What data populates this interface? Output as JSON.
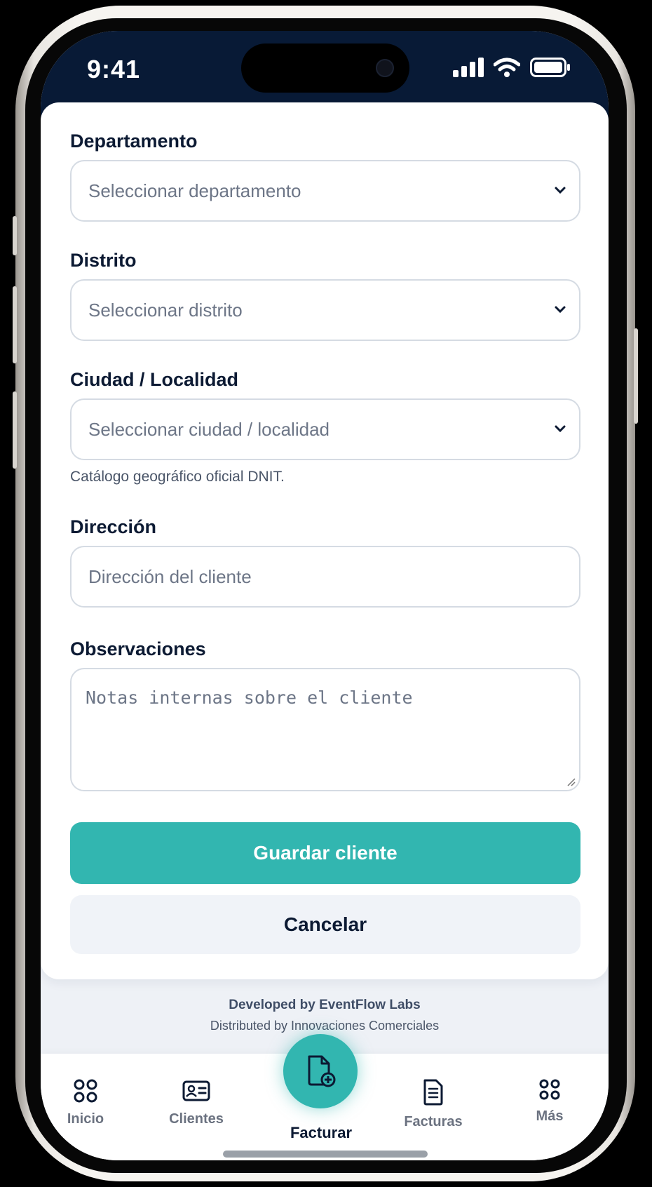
{
  "status_bar": {
    "time": "9:41"
  },
  "form": {
    "departamento": {
      "label": "Departamento",
      "placeholder": "Seleccionar departamento"
    },
    "distrito": {
      "label": "Distrito",
      "placeholder": "Seleccionar distrito"
    },
    "ciudad": {
      "label": "Ciudad / Localidad",
      "placeholder": "Seleccionar ciudad / localidad",
      "help": "Catálogo geográfico oficial DNIT."
    },
    "direccion": {
      "label": "Dirección",
      "placeholder": "Dirección del cliente"
    },
    "observaciones": {
      "label": "Observaciones",
      "placeholder": "Notas internas sobre el cliente"
    },
    "save_label": "Guardar cliente",
    "cancel_label": "Cancelar"
  },
  "footer": {
    "developed": "Developed by EventFlow Labs",
    "distributed": "Distributed by Innovaciones Comerciales"
  },
  "tabs": [
    {
      "label": "Inicio",
      "icon": "grid-icon"
    },
    {
      "label": "Clientes",
      "icon": "id-card-icon"
    },
    {
      "label": "Facturar",
      "icon": "new-document-icon",
      "active": true
    },
    {
      "label": "Facturas",
      "icon": "receipt-icon"
    },
    {
      "label": "Más",
      "icon": "grid-icon"
    }
  ],
  "colors": {
    "accent": "#32b6b0",
    "header": "#081a36",
    "text": "#0c1a33"
  }
}
